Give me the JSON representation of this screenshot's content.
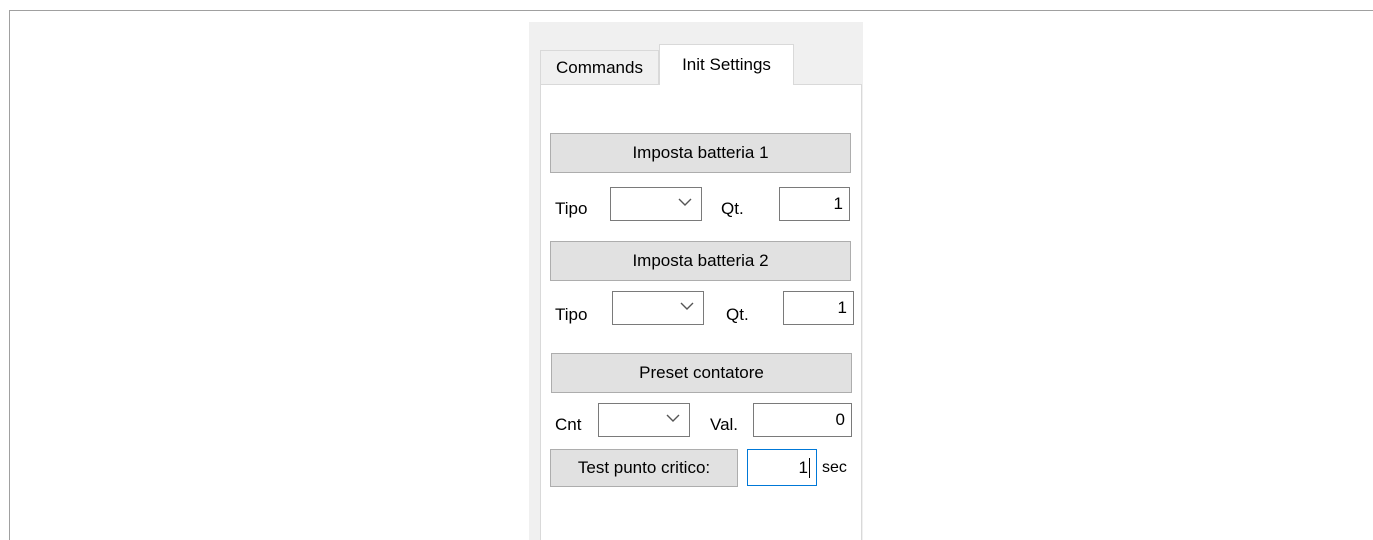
{
  "tabs": [
    {
      "label": "Commands",
      "active": false
    },
    {
      "label": "Init Settings",
      "active": true
    }
  ],
  "battery1": {
    "button_label": "Imposta batteria 1",
    "type_label": "Tipo",
    "type_value": "",
    "qty_label": "Qt.",
    "qty_value": "1"
  },
  "battery2": {
    "button_label": "Imposta batteria 2",
    "type_label": "Tipo",
    "type_value": "",
    "qty_label": "Qt.",
    "qty_value": "1"
  },
  "counter": {
    "button_label": "Preset contatore",
    "cnt_label": "Cnt",
    "cnt_value": "",
    "val_label": "Val.",
    "val_value": "0"
  },
  "critical_test": {
    "button_label": "Test punto critico:",
    "value": "1",
    "unit": "sec"
  },
  "icons": {
    "dropdown": "chevron-down-icon"
  },
  "colors": {
    "focus_border": "#0078d7",
    "button_bg": "#e1e1e1",
    "panel_bg": "#f0f0f0"
  }
}
